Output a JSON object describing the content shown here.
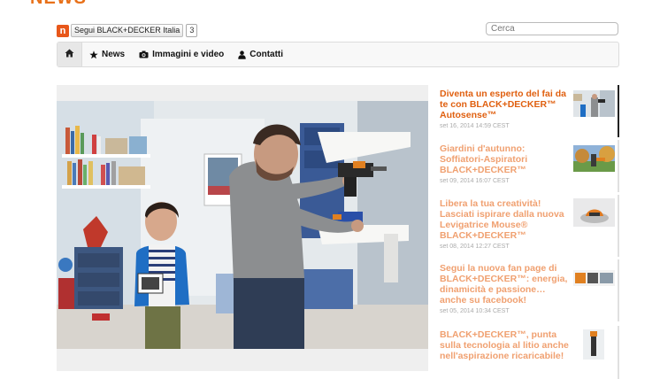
{
  "page": {
    "heading": "NEWS"
  },
  "follow": {
    "logo": "n",
    "label": "Segui BLACK+DECKER Italia",
    "count": "3"
  },
  "search": {
    "placeholder": "Cerca"
  },
  "nav": {
    "home_icon": "home-icon",
    "items": [
      {
        "label": "News",
        "icon": "star-icon"
      },
      {
        "label": "Immagini e video",
        "icon": "camera-icon"
      },
      {
        "label": "Contatti",
        "icon": "user-icon"
      }
    ]
  },
  "colors": {
    "accent": "#e06010",
    "accent_light": "#f0a070",
    "nav_bg": "#f8f8f8"
  },
  "news": [
    {
      "title": "Diventa un esperto del fai da te con BLACK+DECKER™ Autosense™",
      "date": "set 16, 2014 14:59 CEST",
      "active": true
    },
    {
      "title": "Giardini d'autunno: Soffiatori-Aspiratori BLACK+DECKER™",
      "date": "set 09, 2014 16:07 CEST",
      "active": false
    },
    {
      "title": "Libera la tua creatività! Lasciati ispirare dalla nuova Levigatrice Mouse® BLACK+DECKER™",
      "date": "set 08, 2014 12:27 CEST",
      "active": false
    },
    {
      "title": "Segui la nuova fan page di BLACK+DECKER™: energia, dinamicità e passione… anche su facebook!",
      "date": "set 05, 2014 10:34 CEST",
      "active": false
    },
    {
      "title": "BLACK+DECKER™, punta sulla tecnologia al litio anche nell'aspirazione ricaricabile!",
      "date": "",
      "active": false
    }
  ]
}
